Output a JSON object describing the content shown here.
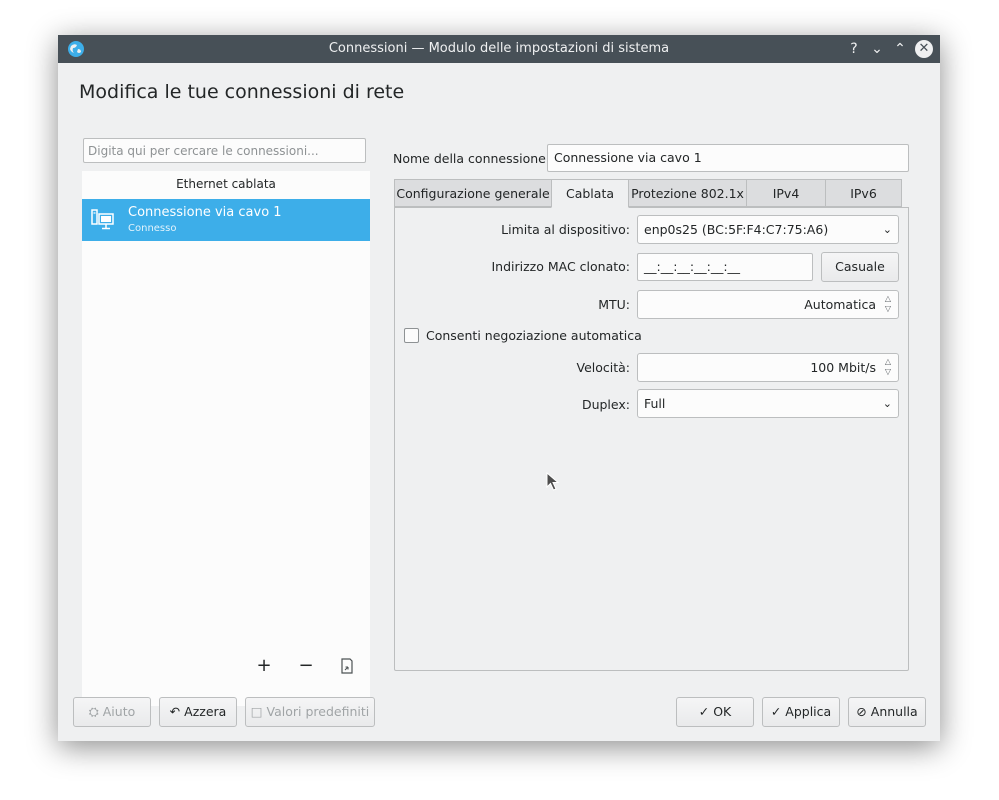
{
  "window": {
    "title": "Connessioni — Modulo delle impostazioni di sistema",
    "buttons": {
      "help": "?",
      "minimize": "⌄",
      "maximize": "⌃",
      "close": "✕"
    }
  },
  "heading": "Modifica le tue connessioni di rete",
  "sidebar": {
    "search_placeholder": "Digita qui per cercare le connessioni...",
    "group_label": "Ethernet cablata",
    "connections": [
      {
        "name": "Connessione via cavo 1",
        "status": "Connesso",
        "icon": "wired-network-icon",
        "selected": true
      }
    ],
    "tools": {
      "add": "+",
      "remove": "−",
      "export": "⎘"
    }
  },
  "form": {
    "name_label": "Nome della connessione:",
    "name_value": "Connessione via cavo 1",
    "tabs": [
      {
        "label": "Configurazione generale"
      },
      {
        "label": "Cablata",
        "active": true
      },
      {
        "label": "Protezione 802.1x"
      },
      {
        "label": "IPv4"
      },
      {
        "label": "IPv6"
      }
    ],
    "wired": {
      "device_label": "Limita al dispositivo:",
      "device_value": "enp0s25 (BC:5F:F4:C7:75:A6)",
      "mac_label": "Indirizzo MAC clonato:",
      "mac_value": "__:__:__:__:__:__",
      "random_button": "Casuale",
      "mtu_label": "MTU:",
      "mtu_value": "Automatica",
      "autoneg_label": "Consenti negoziazione automatica",
      "autoneg_checked": false,
      "speed_label": "Velocità:",
      "speed_value": "100 Mbit/s",
      "duplex_label": "Duplex:",
      "duplex_value": "Full"
    }
  },
  "footer": {
    "help": "Aiuto",
    "reset": "Azzera",
    "defaults": "Valori predefiniti",
    "ok": "OK",
    "apply": "Applica",
    "cancel": "Annulla"
  },
  "colors": {
    "titlebar": "#475057",
    "selection": "#3daee9",
    "window_bg": "#eff0f1"
  }
}
